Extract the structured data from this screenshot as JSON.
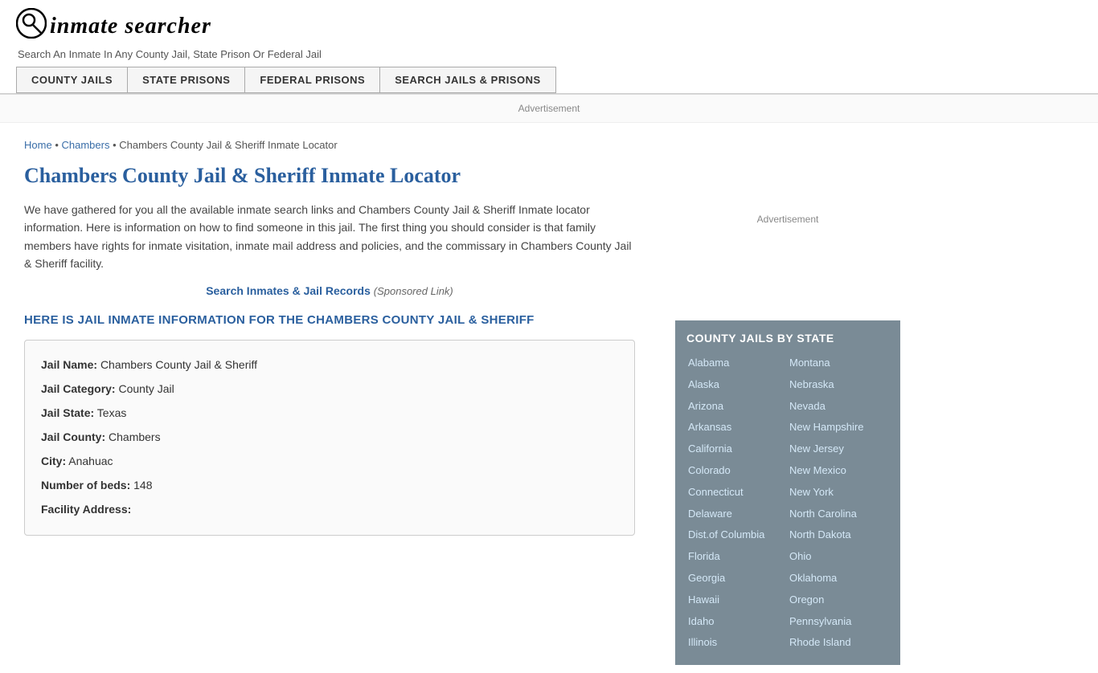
{
  "header": {
    "logo_text": "inmate searcher",
    "tagline": "Search An Inmate In Any County Jail, State Prison Or Federal Jail",
    "nav": [
      {
        "label": "COUNTY JAILS"
      },
      {
        "label": "STATE PRISONS"
      },
      {
        "label": "FEDERAL PRISONS"
      },
      {
        "label": "SEARCH JAILS & PRISONS"
      }
    ]
  },
  "ad_bar": {
    "text": "Advertisement"
  },
  "breadcrumb": {
    "home": "Home",
    "separator": "•",
    "chambers": "Chambers",
    "current": "Chambers County Jail & Sheriff Inmate Locator"
  },
  "page": {
    "title": "Chambers County Jail & Sheriff Inmate Locator",
    "description": "We have gathered for you all the available inmate search links and Chambers County Jail & Sheriff Inmate locator information. Here is information on how to find someone in this jail. The first thing you should consider is that family members have rights for inmate visitation, inmate mail address and policies, and the commissary in Chambers County Jail & Sheriff facility.",
    "search_link_text": "Search Inmates & Jail Records",
    "search_link_sponsored": "(Sponsored Link)",
    "info_heading": "HERE IS JAIL INMATE INFORMATION FOR THE CHAMBERS COUNTY JAIL & SHERIFF",
    "jail_info": {
      "jail_name_label": "Jail Name:",
      "jail_name_value": "Chambers County Jail & Sheriff",
      "jail_category_label": "Jail Category:",
      "jail_category_value": "County Jail",
      "jail_state_label": "Jail State:",
      "jail_state_value": "Texas",
      "jail_county_label": "Jail County:",
      "jail_county_value": "Chambers",
      "city_label": "City:",
      "city_value": "Anahuac",
      "beds_label": "Number of beds:",
      "beds_value": "148",
      "address_label": "Facility Address:"
    }
  },
  "sidebar": {
    "ad_text": "Advertisement",
    "county_jails_heading": "COUNTY JAILS BY STATE",
    "states_col1": [
      "Alabama",
      "Alaska",
      "Arizona",
      "Arkansas",
      "California",
      "Colorado",
      "Connecticut",
      "Delaware",
      "Dist.of Columbia",
      "Florida",
      "Georgia",
      "Hawaii",
      "Idaho",
      "Illinois"
    ],
    "states_col2": [
      "Montana",
      "Nebraska",
      "Nevada",
      "New Hampshire",
      "New Jersey",
      "New Mexico",
      "New York",
      "North Carolina",
      "North Dakota",
      "Ohio",
      "Oklahoma",
      "Oregon",
      "Pennsylvania",
      "Rhode Island"
    ]
  }
}
